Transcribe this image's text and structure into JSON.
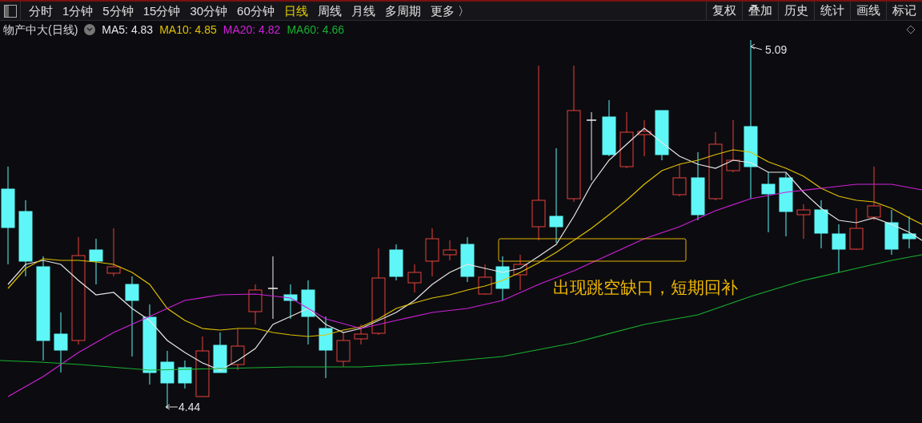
{
  "toolbar": {
    "periods": [
      {
        "label": "分时",
        "selected": false
      },
      {
        "label": "1分钟",
        "selected": false
      },
      {
        "label": "5分钟",
        "selected": false
      },
      {
        "label": "15分钟",
        "selected": false
      },
      {
        "label": "30分钟",
        "selected": false
      },
      {
        "label": "60分钟",
        "selected": false
      },
      {
        "label": "日线",
        "selected": true
      },
      {
        "label": "周线",
        "selected": false
      },
      {
        "label": "月线",
        "selected": false
      },
      {
        "label": "多周期",
        "selected": false
      },
      {
        "label": "更多 〉",
        "selected": false
      }
    ],
    "tools": [
      "复权",
      "叠加",
      "历史",
      "统计",
      "画线",
      "标记"
    ]
  },
  "legend": {
    "title": "物产中大(日线)",
    "indicators": [
      {
        "label": "MA5: 4.83",
        "color": "#e6e6e6"
      },
      {
        "label": "MA10: 4.85",
        "color": "#e0c000"
      },
      {
        "label": "MA20: 4.82",
        "color": "#d020d8"
      },
      {
        "label": "MA60: 4.66",
        "color": "#18b030"
      }
    ]
  },
  "chart": {
    "high_label": "5.09",
    "low_label": "4.44",
    "annotation": "出现跳空缺口，短期回补"
  }
}
